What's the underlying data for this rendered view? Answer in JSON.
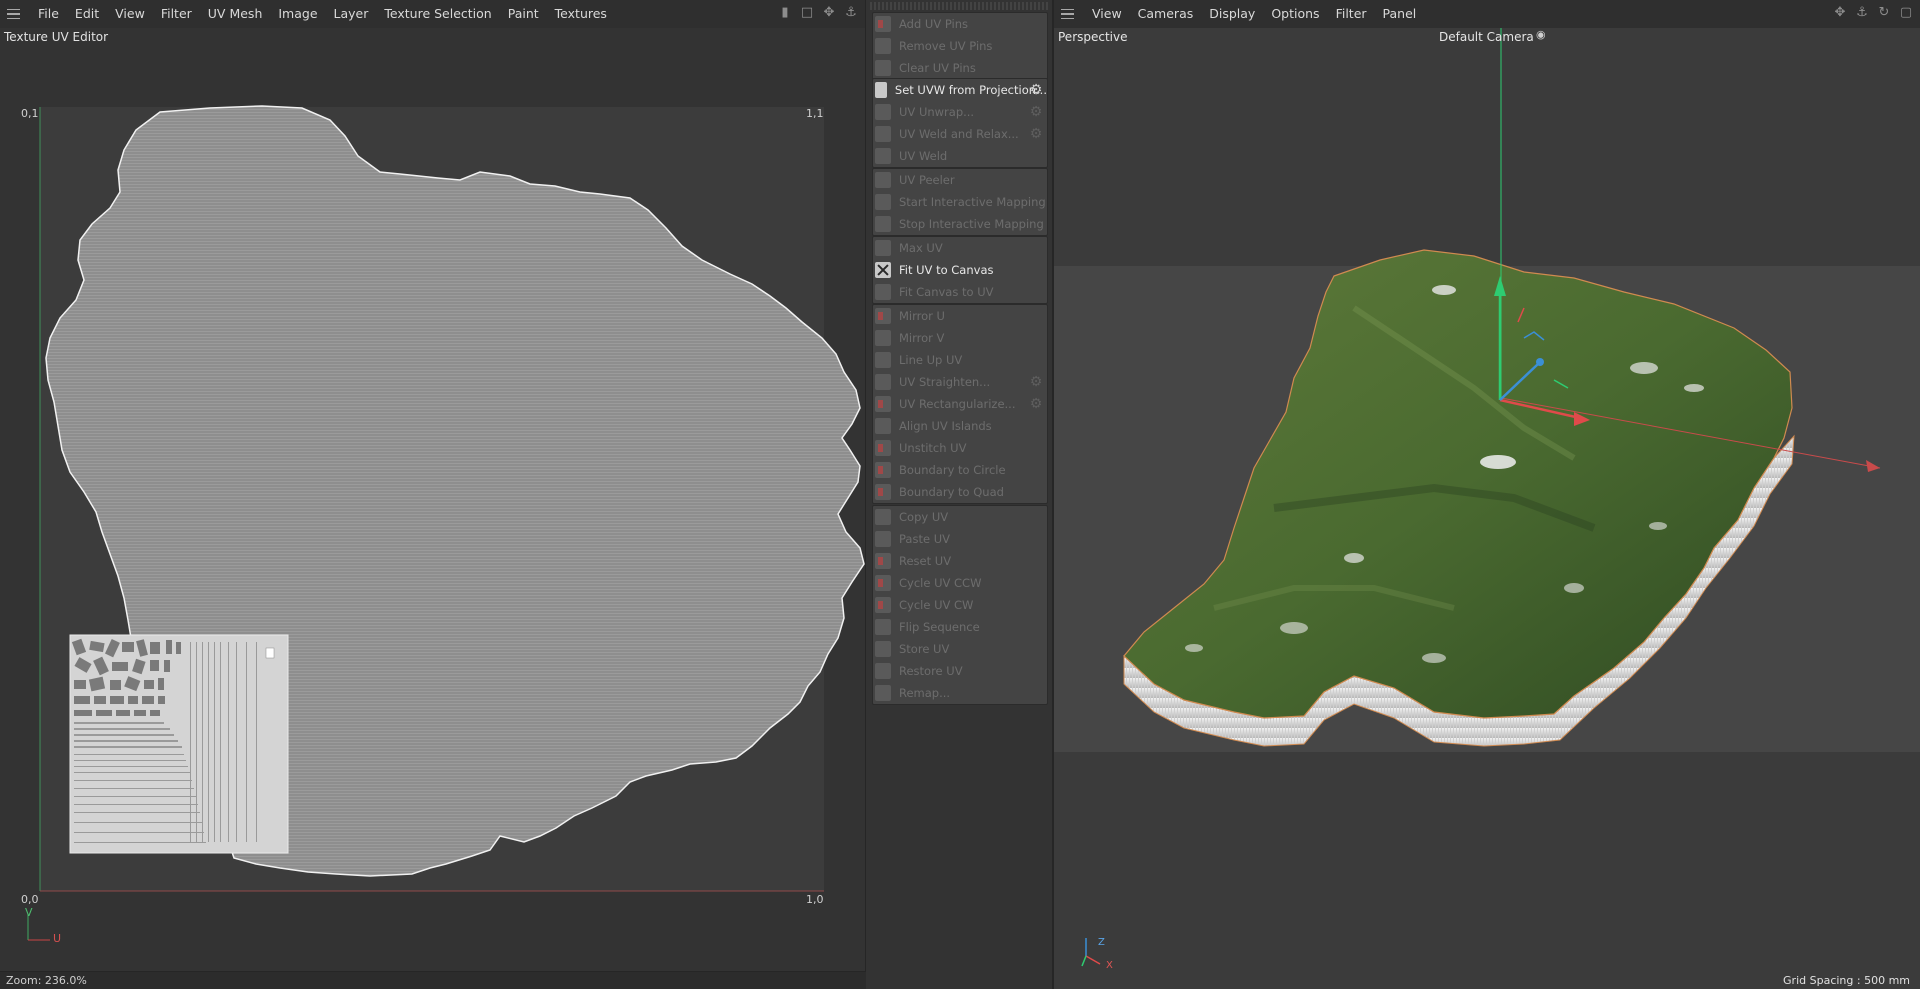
{
  "uv_editor": {
    "menu": [
      "File",
      "Edit",
      "View",
      "Filter",
      "UV Mesh",
      "Image",
      "Layer",
      "Texture Selection",
      "Paint",
      "Textures"
    ],
    "title": "Texture UV Editor",
    "corners": {
      "top_left": "0,1",
      "top_right": "1,1",
      "bottom_left": "0,0",
      "bottom_right": "1,0"
    },
    "axis_v": "V",
    "axis_u": "U",
    "zoom": "Zoom: 236.0%"
  },
  "commands": {
    "groups": [
      [
        {
          "label": "Add UV Pins",
          "icon": "pin-add-icon",
          "active": false
        },
        {
          "label": "Remove UV Pins",
          "icon": "pin-remove-icon",
          "active": false
        },
        {
          "label": "Clear UV Pins",
          "icon": "pin-clear-icon",
          "active": false
        }
      ],
      [
        {
          "label": "Set UVW from Projection...",
          "icon": "checker-icon",
          "active": true,
          "gear": true
        },
        {
          "label": "UV Unwrap...",
          "icon": "unwrap-icon",
          "active": false,
          "gear": true
        },
        {
          "label": "UV Weld and Relax...",
          "icon": "weld-relax-icon",
          "active": false,
          "gear": true
        },
        {
          "label": "UV Weld",
          "icon": "weld-icon",
          "active": false
        }
      ],
      [
        {
          "label": "UV Peeler",
          "icon": "peeler-icon",
          "active": false
        },
        {
          "label": "Start Interactive Mapping",
          "icon": "start-mapping-icon",
          "active": false
        },
        {
          "label": "Stop Interactive Mapping",
          "icon": "stop-mapping-icon",
          "active": false
        }
      ],
      [
        {
          "label": "Max UV",
          "icon": "max-uv-icon",
          "active": false
        },
        {
          "label": "Fit UV to Canvas",
          "icon": "fit-uv-icon",
          "active": true
        },
        {
          "label": "Fit Canvas to UV",
          "icon": "fit-canvas-icon",
          "active": false
        }
      ],
      [
        {
          "label": "Mirror U",
          "icon": "mirror-u-icon",
          "active": false
        },
        {
          "label": "Mirror V",
          "icon": "mirror-v-icon",
          "active": false
        },
        {
          "label": "Line Up UV",
          "icon": "line-up-icon",
          "active": false
        },
        {
          "label": "UV Straighten...",
          "icon": "straighten-icon",
          "active": false,
          "gear": true
        },
        {
          "label": "UV Rectangularize...",
          "icon": "rectangularize-icon",
          "active": false,
          "gear": true
        },
        {
          "label": "Align UV Islands",
          "icon": "align-icon",
          "active": false
        },
        {
          "label": "Unstitch UV",
          "icon": "unstitch-icon",
          "active": false
        },
        {
          "label": "Boundary to Circle",
          "icon": "circle-icon",
          "active": false
        },
        {
          "label": "Boundary to Quad",
          "icon": "quad-icon",
          "active": false
        }
      ],
      [
        {
          "label": "Copy UV",
          "icon": "copy-icon",
          "active": false
        },
        {
          "label": "Paste UV",
          "icon": "paste-icon",
          "active": false
        },
        {
          "label": "Reset UV",
          "icon": "reset-icon",
          "active": false
        },
        {
          "label": "Cycle UV CCW",
          "icon": "cycle-ccw-icon",
          "active": false
        },
        {
          "label": "Cycle UV CW",
          "icon": "cycle-cw-icon",
          "active": false
        },
        {
          "label": "Flip Sequence",
          "icon": "flip-icon",
          "active": false
        },
        {
          "label": "Store UV",
          "icon": "store-icon",
          "active": false
        },
        {
          "label": "Restore UV",
          "icon": "restore-icon",
          "active": false
        },
        {
          "label": "Remap...",
          "icon": "remap-icon",
          "active": false
        }
      ]
    ]
  },
  "viewport": {
    "menu": [
      "View",
      "Cameras",
      "Display",
      "Options",
      "Filter",
      "Panel"
    ],
    "mode": "Perspective",
    "camera": "Default Camera",
    "grid_spacing": "Grid Spacing : 500 mm",
    "axis_z": "Z",
    "axis_x": "X"
  },
  "colors": {
    "terrain": "#4f6b32",
    "uv_fill": "#909090",
    "axis_green": "#2ecc71",
    "axis_red": "#d24a4a",
    "axis_blue": "#3b8fd6"
  }
}
